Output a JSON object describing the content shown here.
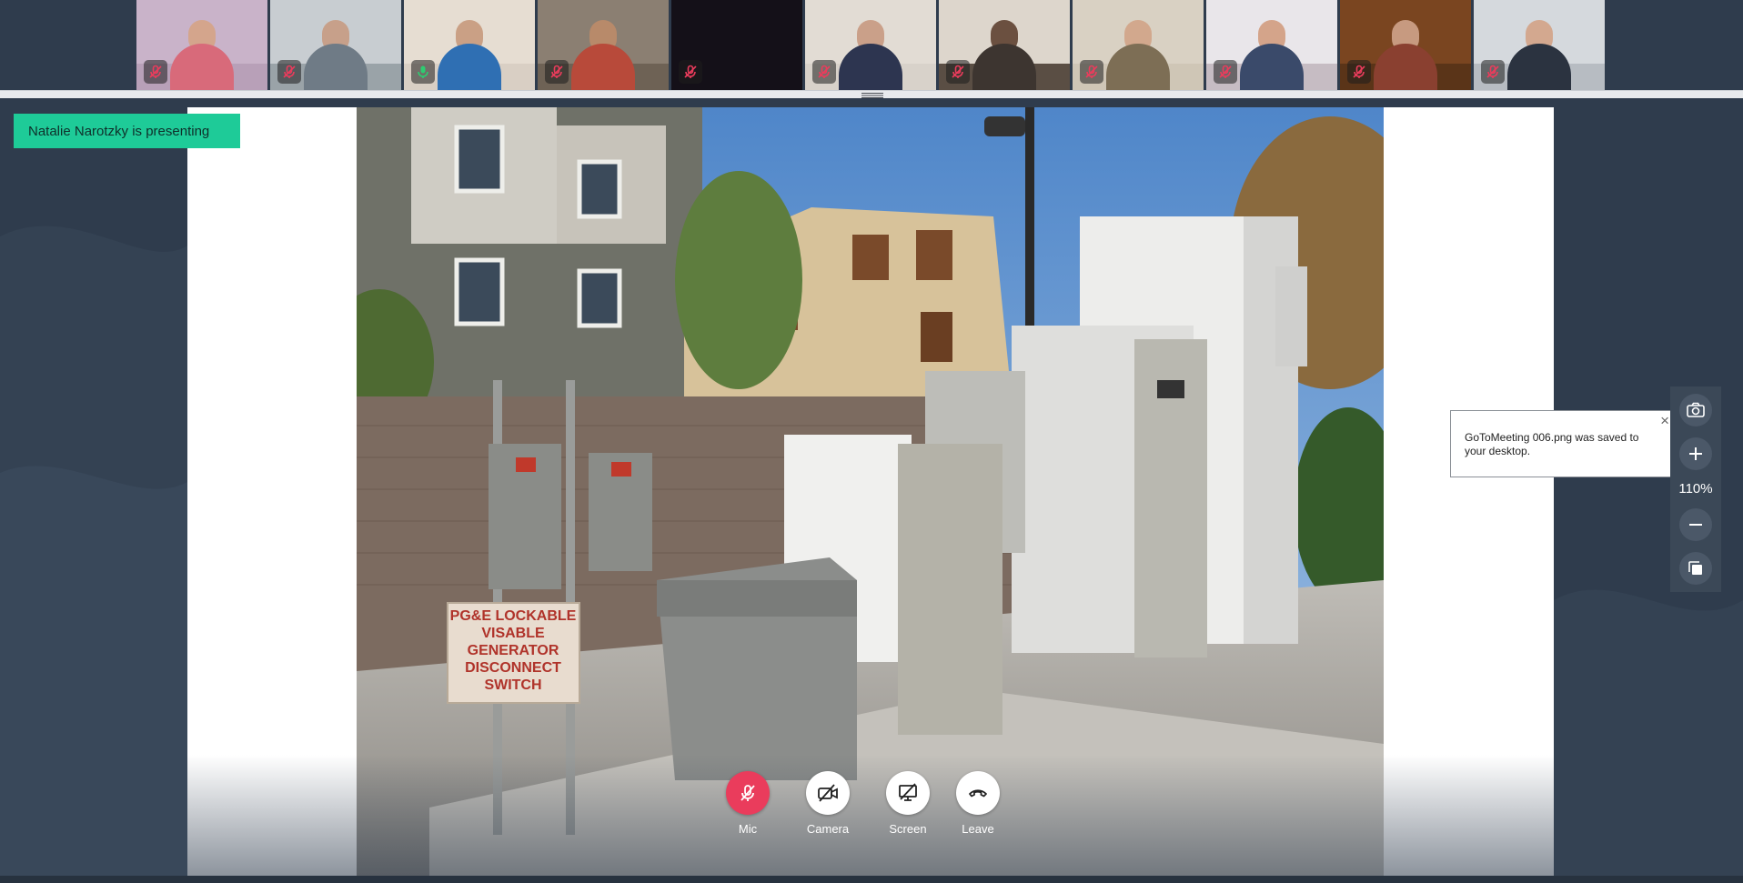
{
  "participants": [
    {
      "mic": "muted"
    },
    {
      "mic": "muted"
    },
    {
      "mic": "active"
    },
    {
      "mic": "muted"
    },
    {
      "mic": "muted"
    },
    {
      "mic": "muted"
    },
    {
      "mic": "muted"
    },
    {
      "mic": "muted"
    },
    {
      "mic": "muted"
    },
    {
      "mic": "muted"
    },
    {
      "mic": "muted"
    }
  ],
  "presenting_banner": "Natalie Narotzky is presenting",
  "shared_content": {
    "sign_lines": [
      "PG&E LOCKABLE",
      "VISABLE",
      "GENERATOR",
      "DISCONNECT",
      "SWITCH"
    ]
  },
  "controls": {
    "mic": "Mic",
    "camera": "Camera",
    "screen": "Screen",
    "leave": "Leave"
  },
  "toast": {
    "message": "GoToMeeting 006.png was saved to your desktop.",
    "close": "×"
  },
  "zoom": {
    "level": "110%"
  },
  "colors": {
    "background": "#2f3c4d",
    "banner": "#1ecb98",
    "mic_muted_red": "#ea3c5c",
    "mic_active_green": "#2ecc71"
  },
  "icons": {
    "screenshot": "camera-capture-icon",
    "zoom_in": "plus-icon",
    "zoom_out": "minus-icon",
    "fit": "copy-pages-icon",
    "mic_off": "microphone-off-icon",
    "camera_off": "camera-off-icon",
    "screen_off": "screen-share-off-icon",
    "leave": "phone-hangup-icon"
  }
}
